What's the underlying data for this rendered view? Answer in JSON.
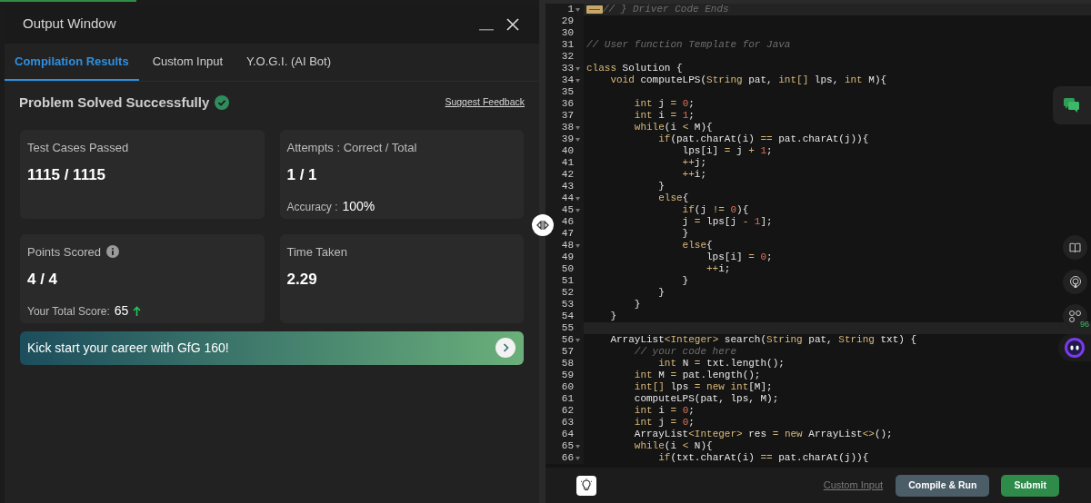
{
  "output_window": {
    "title": "Output Window",
    "tabs": [
      {
        "label": "Compilation Results",
        "selected": true
      },
      {
        "label": "Custom Input",
        "selected": false
      },
      {
        "label": "Y.O.G.I. (AI Bot)",
        "selected": false
      }
    ],
    "status": "Problem Solved Successfully",
    "feedback_link": "Suggest Feedback",
    "cards": [
      {
        "label": "Test Cases Passed",
        "info": false,
        "value": "1115 / 1115"
      },
      {
        "label": "Attempts : Correct / Total",
        "info": false,
        "value": "1 / 1",
        "extra_label": "Accuracy :",
        "extra_value": "100%"
      },
      {
        "label": "Points Scored",
        "info": true,
        "value": "4 / 4",
        "extra_label": "Your Total Score:",
        "extra_value": "65",
        "score_up": true
      },
      {
        "label": "Time Taken",
        "info": false,
        "value": "2.29"
      }
    ],
    "banner": "Kick start your career with GfG 160!"
  },
  "editor": {
    "lines": [
      {
        "number": "1",
        "fold": true,
        "folded": true,
        "active": true,
        "tokens": [
          {
            "kind": "comment",
            "text": "// } Driver Code Ends"
          }
        ]
      },
      {
        "number": "29",
        "fold": false,
        "folded": false,
        "active": false
      },
      {
        "number": "30",
        "fold": false,
        "folded": false,
        "active": false
      },
      {
        "number": "31",
        "fold": false,
        "folded": false,
        "active": false,
        "tokens": [
          {
            "kind": "comment",
            "text": "// User function Template for Java"
          }
        ]
      },
      {
        "number": "32",
        "fold": false,
        "folded": false,
        "active": false
      },
      {
        "number": "33",
        "fold": true,
        "folded": false,
        "active": false,
        "tokens": [
          {
            "kind": "keyword",
            "text": "class"
          },
          {
            "kind": "plain",
            "text": " Solution {"
          }
        ]
      },
      {
        "number": "34",
        "fold": true,
        "folded": false,
        "active": false,
        "tokens": [
          {
            "kind": "keyword",
            "text": "    void"
          },
          {
            "kind": "plain",
            "text": " computeLPS("
          },
          {
            "kind": "keyword",
            "text": "String"
          },
          {
            "kind": "plain",
            "text": " pat, "
          },
          {
            "kind": "keyword",
            "text": "int"
          },
          {
            "kind": "operator",
            "text": "[]"
          },
          {
            "kind": "plain",
            "text": " lps, "
          },
          {
            "kind": "keyword",
            "text": "int"
          },
          {
            "kind": "plain",
            "text": " M){"
          }
        ]
      },
      {
        "number": "35",
        "fold": false,
        "folded": false,
        "active": false
      },
      {
        "number": "36",
        "fold": false,
        "folded": false,
        "active": false,
        "tokens": [
          {
            "kind": "keyword",
            "text": "        int"
          },
          {
            "kind": "plain",
            "text": " j "
          },
          {
            "kind": "operator",
            "text": "= "
          },
          {
            "kind": "number",
            "text": "0"
          },
          {
            "kind": "plain",
            "text": ";"
          }
        ]
      },
      {
        "number": "37",
        "fold": false,
        "folded": false,
        "active": false,
        "tokens": [
          {
            "kind": "keyword",
            "text": "        int"
          },
          {
            "kind": "plain",
            "text": " i "
          },
          {
            "kind": "operator",
            "text": "= "
          },
          {
            "kind": "number",
            "text": "1"
          },
          {
            "kind": "plain",
            "text": ";"
          }
        ]
      },
      {
        "number": "38",
        "fold": true,
        "folded": false,
        "active": false,
        "tokens": [
          {
            "kind": "keyword",
            "text": "        while"
          },
          {
            "kind": "plain",
            "text": "(i "
          },
          {
            "kind": "operator",
            "text": "<"
          },
          {
            "kind": "plain",
            "text": " M){"
          }
        ]
      },
      {
        "number": "39",
        "fold": true,
        "folded": false,
        "active": false,
        "tokens": [
          {
            "kind": "keyword",
            "text": "            if"
          },
          {
            "kind": "plain",
            "text": "(pat.charAt(i) "
          },
          {
            "kind": "operator",
            "text": "=="
          },
          {
            "kind": "plain",
            "text": " pat.charAt(j)){"
          }
        ]
      },
      {
        "number": "40",
        "fold": false,
        "folded": false,
        "active": false,
        "tokens": [
          {
            "kind": "plain",
            "text": "                lps[i] "
          },
          {
            "kind": "operator",
            "text": "="
          },
          {
            "kind": "plain",
            "text": " j "
          },
          {
            "kind": "operator",
            "text": "+ "
          },
          {
            "kind": "number",
            "text": "1"
          },
          {
            "kind": "plain",
            "text": ";"
          }
        ]
      },
      {
        "number": "41",
        "fold": false,
        "folded": false,
        "active": false,
        "tokens": [
          {
            "kind": "operator",
            "text": "                ++"
          },
          {
            "kind": "plain",
            "text": "j;"
          }
        ]
      },
      {
        "number": "42",
        "fold": false,
        "folded": false,
        "active": false,
        "tokens": [
          {
            "kind": "operator",
            "text": "                ++"
          },
          {
            "kind": "plain",
            "text": "i;"
          }
        ]
      },
      {
        "number": "43",
        "fold": false,
        "folded": false,
        "active": false,
        "tokens": [
          {
            "kind": "plain",
            "text": "            }"
          }
        ]
      },
      {
        "number": "44",
        "fold": true,
        "folded": false,
        "active": false,
        "tokens": [
          {
            "kind": "keyword",
            "text": "            else"
          },
          {
            "kind": "plain",
            "text": "{"
          }
        ]
      },
      {
        "number": "45",
        "fold": true,
        "folded": false,
        "active": false,
        "tokens": [
          {
            "kind": "keyword",
            "text": "                if"
          },
          {
            "kind": "plain",
            "text": "(j "
          },
          {
            "kind": "operator",
            "text": "!= "
          },
          {
            "kind": "number",
            "text": "0"
          },
          {
            "kind": "plain",
            "text": "){"
          }
        ]
      },
      {
        "number": "46",
        "fold": false,
        "folded": false,
        "active": false,
        "tokens": [
          {
            "kind": "plain",
            "text": "                j "
          },
          {
            "kind": "operator",
            "text": "="
          },
          {
            "kind": "plain",
            "text": " lps[j "
          },
          {
            "kind": "operator",
            "text": "- "
          },
          {
            "kind": "number",
            "text": "1"
          },
          {
            "kind": "plain",
            "text": "];"
          }
        ]
      },
      {
        "number": "47",
        "fold": false,
        "folded": false,
        "active": false,
        "tokens": [
          {
            "kind": "plain",
            "text": "                }"
          }
        ]
      },
      {
        "number": "48",
        "fold": true,
        "folded": false,
        "active": false,
        "tokens": [
          {
            "kind": "keyword",
            "text": "                else"
          },
          {
            "kind": "plain",
            "text": "{"
          }
        ]
      },
      {
        "number": "49",
        "fold": false,
        "folded": false,
        "active": false,
        "tokens": [
          {
            "kind": "plain",
            "text": "                    lps[i] "
          },
          {
            "kind": "operator",
            "text": "= "
          },
          {
            "kind": "number",
            "text": "0"
          },
          {
            "kind": "plain",
            "text": ";"
          }
        ]
      },
      {
        "number": "50",
        "fold": false,
        "folded": false,
        "active": false,
        "tokens": [
          {
            "kind": "operator",
            "text": "                    ++"
          },
          {
            "kind": "plain",
            "text": "i;"
          }
        ]
      },
      {
        "number": "51",
        "fold": false,
        "folded": false,
        "active": false,
        "tokens": [
          {
            "kind": "plain",
            "text": "                }"
          }
        ]
      },
      {
        "number": "52",
        "fold": false,
        "folded": false,
        "active": false,
        "tokens": [
          {
            "kind": "plain",
            "text": "            }"
          }
        ]
      },
      {
        "number": "53",
        "fold": false,
        "folded": false,
        "active": false,
        "tokens": [
          {
            "kind": "plain",
            "text": "        }"
          }
        ]
      },
      {
        "number": "54",
        "fold": false,
        "folded": false,
        "active": false,
        "tokens": [
          {
            "kind": "plain",
            "text": "    }"
          }
        ]
      },
      {
        "number": "55",
        "fold": false,
        "folded": false,
        "active": true
      },
      {
        "number": "56",
        "fold": true,
        "folded": false,
        "active": false,
        "tokens": [
          {
            "kind": "plain",
            "text": "    ArrayList"
          },
          {
            "kind": "operator",
            "text": "<"
          },
          {
            "kind": "keyword",
            "text": "Integer"
          },
          {
            "kind": "operator",
            "text": ">"
          },
          {
            "kind": "plain",
            "text": " search("
          },
          {
            "kind": "keyword",
            "text": "String"
          },
          {
            "kind": "plain",
            "text": " pat, "
          },
          {
            "kind": "keyword",
            "text": "String"
          },
          {
            "kind": "plain",
            "text": " txt) {"
          }
        ]
      },
      {
        "number": "57",
        "fold": false,
        "folded": false,
        "active": false,
        "tokens": [
          {
            "kind": "comment",
            "text": "        // your code here"
          }
        ]
      },
      {
        "number": "58",
        "fold": false,
        "folded": false,
        "active": false,
        "tokens": [
          {
            "kind": "keyword",
            "text": "            int"
          },
          {
            "kind": "plain",
            "text": " N "
          },
          {
            "kind": "operator",
            "text": "="
          },
          {
            "kind": "plain",
            "text": " txt.length();"
          }
        ]
      },
      {
        "number": "59",
        "fold": false,
        "folded": false,
        "active": false,
        "tokens": [
          {
            "kind": "keyword",
            "text": "        int"
          },
          {
            "kind": "plain",
            "text": " M "
          },
          {
            "kind": "operator",
            "text": "="
          },
          {
            "kind": "plain",
            "text": " pat.length();"
          }
        ]
      },
      {
        "number": "60",
        "fold": false,
        "folded": false,
        "active": false,
        "tokens": [
          {
            "kind": "keyword",
            "text": "        int"
          },
          {
            "kind": "operator",
            "text": "[]"
          },
          {
            "kind": "plain",
            "text": " lps "
          },
          {
            "kind": "operator",
            "text": "="
          },
          {
            "kind": "keyword",
            "text": " new int"
          },
          {
            "kind": "plain",
            "text": "[M];"
          }
        ]
      },
      {
        "number": "61",
        "fold": false,
        "folded": false,
        "active": false,
        "tokens": [
          {
            "kind": "plain",
            "text": "        computeLPS(pat, lps, M);"
          }
        ]
      },
      {
        "number": "62",
        "fold": false,
        "folded": false,
        "active": false,
        "tokens": [
          {
            "kind": "keyword",
            "text": "        int"
          },
          {
            "kind": "plain",
            "text": " i "
          },
          {
            "kind": "operator",
            "text": "= "
          },
          {
            "kind": "number",
            "text": "0"
          },
          {
            "kind": "plain",
            "text": ";"
          }
        ]
      },
      {
        "number": "63",
        "fold": false,
        "folded": false,
        "active": false,
        "tokens": [
          {
            "kind": "keyword",
            "text": "        int"
          },
          {
            "kind": "plain",
            "text": " j "
          },
          {
            "kind": "operator",
            "text": "= "
          },
          {
            "kind": "number",
            "text": "0"
          },
          {
            "kind": "plain",
            "text": ";"
          }
        ]
      },
      {
        "number": "64",
        "fold": false,
        "folded": false,
        "active": false,
        "tokens": [
          {
            "kind": "plain",
            "text": "        ArrayList"
          },
          {
            "kind": "operator",
            "text": "<"
          },
          {
            "kind": "keyword",
            "text": "Integer"
          },
          {
            "kind": "operator",
            "text": ">"
          },
          {
            "kind": "plain",
            "text": " res "
          },
          {
            "kind": "operator",
            "text": "="
          },
          {
            "kind": "keyword",
            "text": " new"
          },
          {
            "kind": "plain",
            "text": " ArrayList"
          },
          {
            "kind": "operator",
            "text": "<>"
          },
          {
            "kind": "plain",
            "text": "();"
          }
        ]
      },
      {
        "number": "65",
        "fold": true,
        "folded": false,
        "active": false,
        "tokens": [
          {
            "kind": "keyword",
            "text": "        while"
          },
          {
            "kind": "plain",
            "text": "(i "
          },
          {
            "kind": "operator",
            "text": "<"
          },
          {
            "kind": "plain",
            "text": " N){"
          }
        ]
      },
      {
        "number": "66",
        "fold": true,
        "folded": false,
        "active": false,
        "tokens": [
          {
            "kind": "keyword",
            "text": "            if"
          },
          {
            "kind": "plain",
            "text": "(txt.charAt(i) "
          },
          {
            "kind": "operator",
            "text": "=="
          },
          {
            "kind": "plain",
            "text": " pat.charAt(j)){"
          }
        ]
      }
    ]
  },
  "side_tools": {
    "badge": "96"
  },
  "bottom_bar": {
    "custom_input": "Custom Input",
    "compile": "Compile & Run",
    "submit": "Submit"
  }
}
